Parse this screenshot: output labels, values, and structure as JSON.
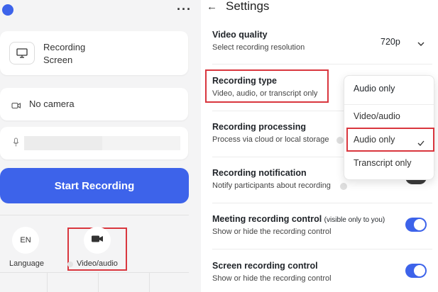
{
  "left": {
    "menu_icon": "more-horizontal-icon",
    "recording_card": {
      "title": "Recording",
      "subtitle": "Screen",
      "icon": "monitor-icon"
    },
    "camera": {
      "label": "No camera",
      "icon": "camera-icon"
    },
    "microphone": {
      "icon": "microphone-icon"
    },
    "start_button": "Start Recording",
    "bottom": {
      "language": {
        "circle_text": "EN",
        "label": "Language"
      },
      "video_audio": {
        "label": "Video/audio",
        "icon": "video-camera-icon"
      }
    }
  },
  "right": {
    "back_icon": "arrow-left-icon",
    "title": "Settings",
    "video_quality": {
      "title": "Video quality",
      "subtitle": "Select recording resolution",
      "value": "720p"
    },
    "recording_type": {
      "title": "Recording type",
      "subtitle": "Video, audio, or transcript only"
    },
    "recording_processing": {
      "title": "Recording processing",
      "subtitle": "Process via cloud or local storage"
    },
    "recording_notification": {
      "title": "Recording notification",
      "subtitle": "Notify participants about recording",
      "enabled": true
    },
    "meeting_recording_control": {
      "title": "Meeting recording control",
      "note": "(visible only to you)",
      "subtitle": "Show or hide the recording control",
      "enabled": true
    },
    "screen_recording_control": {
      "title": "Screen recording control",
      "subtitle": "Show or hide the recording control",
      "enabled": true
    },
    "dropdown": {
      "current": "Audio only",
      "options": [
        "Video/audio",
        "Audio only",
        "Transcript only"
      ],
      "selected": "Audio only"
    }
  },
  "colors": {
    "accent": "#3d63ea",
    "highlight": "#d9363e"
  }
}
